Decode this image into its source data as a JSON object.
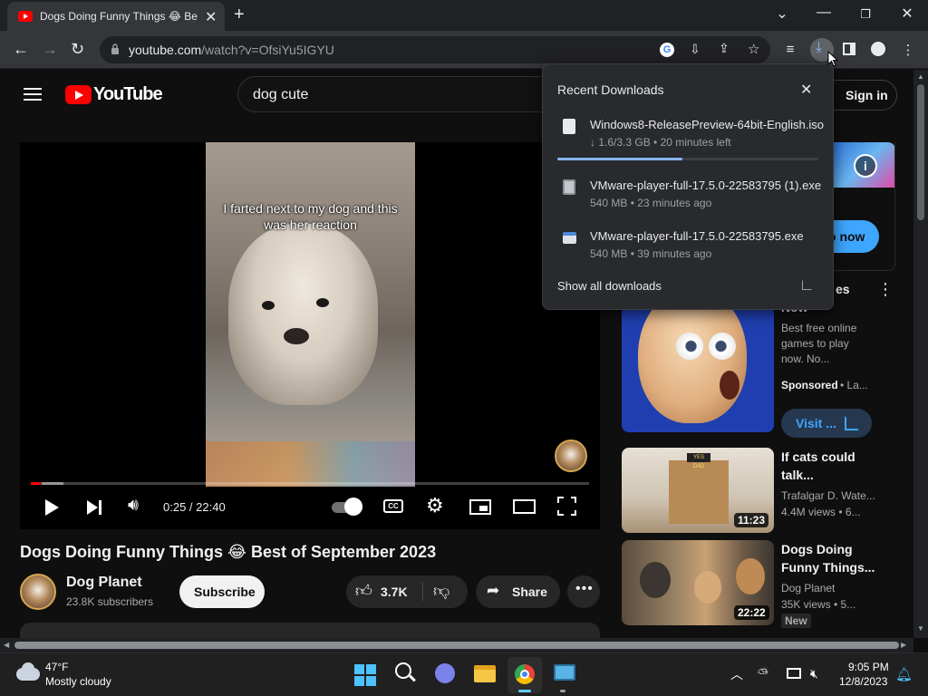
{
  "browser": {
    "tab_title": "Dogs Doing Funny Things 😂 Be",
    "url_host": "youtube.com",
    "url_path": "/watch?v=OfsiYu5IGYU"
  },
  "downloads": {
    "heading": "Recent Downloads",
    "items": [
      {
        "name": "Windows8-ReleasePreview-64bit-English.iso",
        "meta": "↓ 1.6/3.3 GB • 20 minutes left",
        "progress": 0.48
      },
      {
        "name": "VMware-player-full-17.5.0-22583795 (1).exe",
        "meta": "540 MB • 23 minutes ago"
      },
      {
        "name": "VMware-player-full-17.5.0-22583795.exe",
        "meta": "540 MB • 39 minutes ago"
      }
    ],
    "show_all": "Show all downloads"
  },
  "youtube": {
    "logo_text": "YouTube",
    "search_value": "dog cute",
    "sign_in": "Sign in",
    "video": {
      "caption": "I farted next to my dog and this was her reaction",
      "time": "0:25 / 22:40",
      "progress": 0.018,
      "title": "Dogs Doing Funny Things 😂 Best of September 2023"
    },
    "channel": {
      "name": "Dog Planet",
      "subscribers": "23.8K subscribers",
      "subscribe": "Subscribe"
    },
    "actions": {
      "likes": "3.7K",
      "share": "Share"
    },
    "ad": {
      "cta": "o now",
      "title_partial": "es",
      "title_line2": "Now",
      "description": "Best free online games to play now. No...",
      "sponsored": "Sponsored",
      "sponsor_suffix": "• La...",
      "visit": "Visit ..."
    },
    "recommendations": [
      {
        "title": "If cats could talk...",
        "channel": "Trafalgar D. Wate...",
        "meta": "4.4M views • 6...",
        "duration": "11:23",
        "thumb_label": "YES DAD"
      },
      {
        "title": "Dogs Doing Funny Things...",
        "channel": "Dog Planet",
        "meta": "35K views • 5...",
        "duration": "22:22",
        "badge": "New"
      }
    ]
  },
  "taskbar": {
    "temperature": "47°F",
    "weather": "Mostly cloudy",
    "time": "9:05 PM",
    "date": "12/8/2023"
  }
}
